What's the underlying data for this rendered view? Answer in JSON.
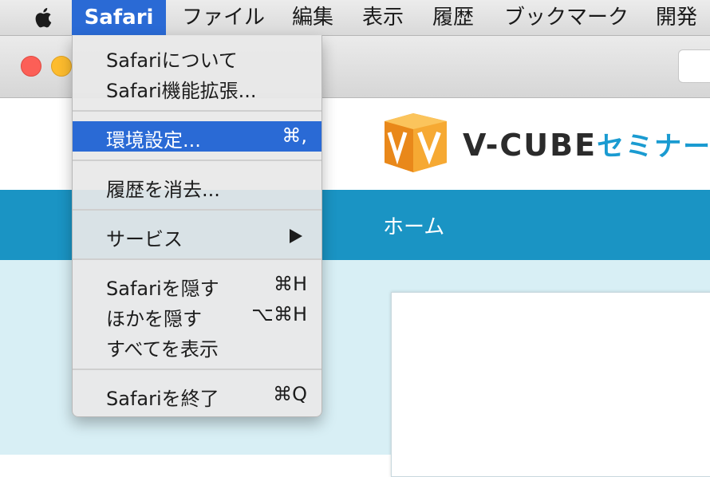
{
  "menubar": {
    "items": [
      "Safari",
      "ファイル",
      "編集",
      "表示",
      "履歴",
      "ブックマーク",
      "開発"
    ]
  },
  "dropdown": {
    "items": [
      {
        "label": "Safariについて",
        "shortcut": ""
      },
      {
        "label": "Safari機能拡張...",
        "shortcut": ""
      },
      {
        "label": "環境設定...",
        "shortcut": "⌘,"
      },
      {
        "label": "履歴を消去...",
        "shortcut": ""
      },
      {
        "label": "サービス",
        "shortcut": ""
      },
      {
        "label": "Safariを隠す",
        "shortcut": "⌘H"
      },
      {
        "label": "ほかを隠す",
        "shortcut": "⌥⌘H"
      },
      {
        "label": "すべてを表示",
        "shortcut": ""
      },
      {
        "label": "Safariを終了",
        "shortcut": "⌘Q"
      }
    ]
  },
  "page": {
    "logo": {
      "name": "V-CUBE",
      "accent": "セミナー"
    },
    "nav": {
      "home": "ホーム"
    }
  },
  "colors": {
    "menu_highlight": "#2a6ad5",
    "nav_bar": "#1a94c4",
    "content_bg": "#d8eff5",
    "logo_orange": "#f39a1f"
  },
  "icons": [
    "apple-logo-icon",
    "submenu-arrow-icon",
    "vcube-logo-icon"
  ]
}
